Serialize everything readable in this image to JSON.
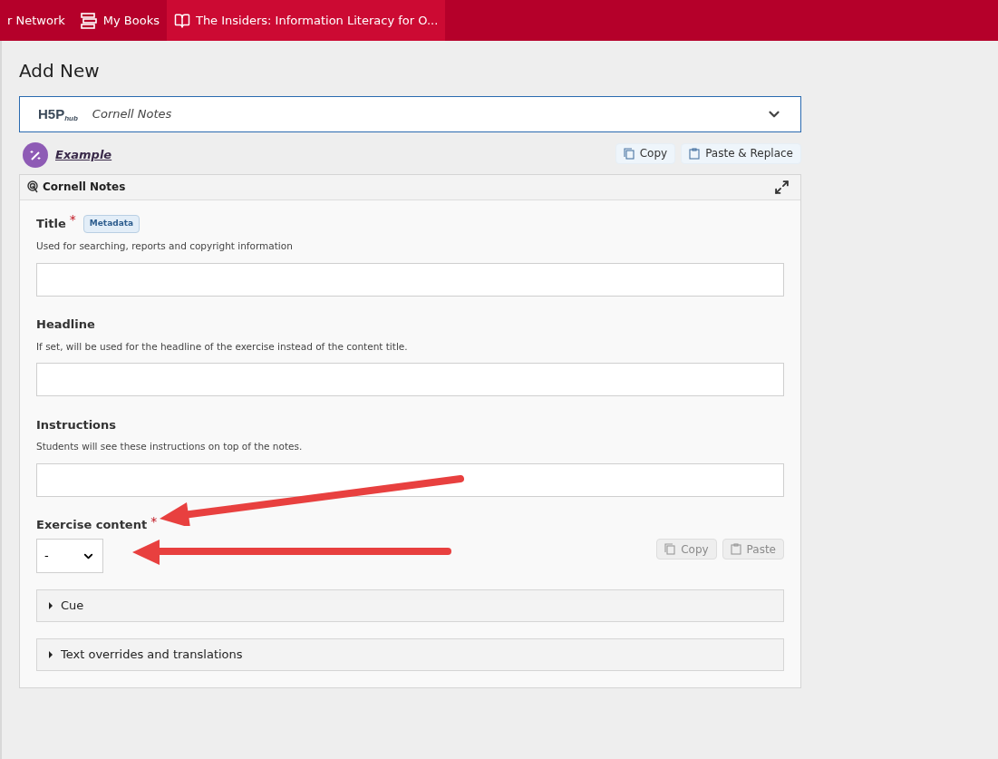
{
  "top_nav": [
    {
      "label": "r Network",
      "selected": false
    },
    {
      "label": "My Books",
      "selected": false
    },
    {
      "label": "The Insiders: Information Literacy for O...",
      "selected": true
    }
  ],
  "page_title": "Add New",
  "content_type_selector": {
    "logo": "H5P",
    "logo_sub": "hub",
    "value": "Cornell Notes",
    "expanded": false
  },
  "example_link": "Example",
  "top_actions": [
    {
      "label": "Copy",
      "kind": "copy",
      "disabled": false
    },
    {
      "label": "Paste & Replace",
      "kind": "paste",
      "disabled": false
    }
  ],
  "editor": {
    "title": "Cornell Notes",
    "fields": [
      {
        "kind": "text",
        "label": "Title",
        "required_mark": "*",
        "tag": "Metadata",
        "description": "Used for searching, reports and copyright information"
      },
      {
        "kind": "text",
        "label": "Headline",
        "description": "If set, will be used for the headline of the exercise instead of the content title."
      },
      {
        "kind": "text",
        "label": "Instructions",
        "description": "Students will see these instructions on top of the notes."
      },
      {
        "kind": "select",
        "label": "Exercise content",
        "required_mark": "*",
        "value": "-",
        "actions": [
          {
            "label": "Copy",
            "kind": "copy",
            "disabled": true
          },
          {
            "label": "Paste",
            "kind": "paste",
            "disabled": true
          }
        ]
      }
    ],
    "sections": [
      {
        "label": "Cue",
        "expanded": false
      },
      {
        "label": "Text overrides and translations",
        "expanded": false
      }
    ]
  }
}
